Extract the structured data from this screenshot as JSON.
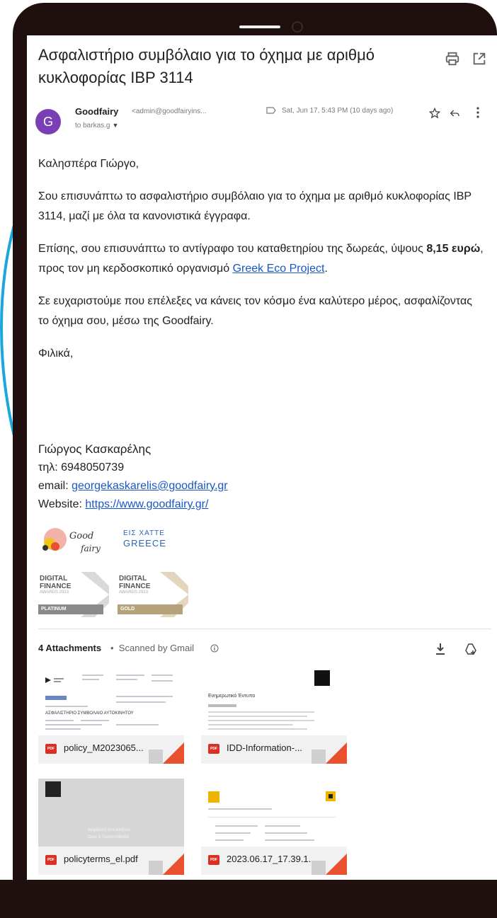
{
  "email": {
    "subject": "Ασφαλιστήριο συμβόλαιο για το όχημα με αριθμό κυκλοφορίας IBP 3114",
    "sender": {
      "avatar_letter": "G",
      "name": "Goodfairy",
      "email": "<admin@goodfairyins...",
      "date": "Sat, Jun 17, 5:43 PM (10 days ago)",
      "to": "to barkas.g"
    },
    "body": {
      "greeting": "Καλησπέρα Γιώργο,",
      "p1": "Σου επισυνάπτω το ασφαλιστήριο συμβόλαιο για το όχημα με αριθμό κυκλοφορίας IBP 3114, μαζί με όλα τα κανονιστικά έγγραφα.",
      "p2_before": "Επίσης, σου επισυνάπτω το αντίγραφο του καταθετηρίου της δωρεάς, ύψους ",
      "p2_bold": "8,15 ευρώ",
      "p2_after": ", προς τον μη κερδοσκοπικό οργανισμό ",
      "p2_link": "Greek Eco Project",
      "p2_end": ".",
      "p3": "Σε ευχαριστούμε που επέλεξες να κάνεις τον κόσμο ένα καλύτερο μέρος, ασφαλίζοντας το όχημα σου, μέσω της Goodfairy.",
      "closing": "Φιλικά,"
    },
    "signature": {
      "name": "Γιώργος Κασκαρέλης",
      "phone_label": "τηλ: ",
      "phone": "6948050739",
      "email_label": "email: ",
      "email": "georgekaskarelis@goodfairy.gr",
      "website_label": "Website: ",
      "website": "https://www.goodfairy.gr/"
    },
    "logos": {
      "goodfairy_line1": "Good",
      "goodfairy_line2": "fairy",
      "greece_line1": "ΕΙΣ ΧΑΤΤΕ",
      "greece_line2": "GREECE"
    },
    "awards": [
      {
        "line1": "DIGITAL",
        "line2": "FINANCE",
        "sub": "AWARDS 2023",
        "tier": "PLATINUM",
        "band_color": "#8a8a8a"
      },
      {
        "line1": "DIGITAL",
        "line2": "FINANCE",
        "sub": "AWARDS 2023",
        "tier": "GOLD",
        "band_color": "#b5a27a"
      }
    ],
    "attachments": {
      "count_label": "4 Attachments",
      "separator": "•",
      "scanned_label": "Scanned by Gmail",
      "items": [
        {
          "name": "policy_M2023065...",
          "badge": "PDF"
        },
        {
          "name": "IDD-Information-...",
          "badge": "PDF"
        },
        {
          "name": "policyterms_el.pdf",
          "badge": "PDF"
        },
        {
          "name": "2023.06.17_17.39.1...",
          "badge": "PDF"
        }
      ],
      "thumb1_heading": "ΑΣΦΑΛΙΣΤΗΡΙΟ ΣΥΜΒΟΛΑΙΟ ΑΥΤΟΚΙΝΗΤΟΥ",
      "thumb2_heading": "Ενημερωτικό Έντυπο",
      "thumb3_text1": "Ασφάλιση Αυτοκινήτου",
      "thumb3_text2": "Όροι & Προϋποθέσεις"
    }
  },
  "icons": {
    "print": "print-icon",
    "open_new": "open-in-new-icon",
    "label": "label-icon",
    "star": "star-icon",
    "reply": "reply-icon",
    "more": "more-vert-icon",
    "info": "info-icon",
    "download": "download-icon",
    "drive": "add-to-drive-icon"
  },
  "colors": {
    "avatar": "#7b3fb5",
    "link": "#1a56c8",
    "frame": "#1f0f0f",
    "pdf_red": "#d93025",
    "accent_cyan": "#1aa7e0"
  }
}
